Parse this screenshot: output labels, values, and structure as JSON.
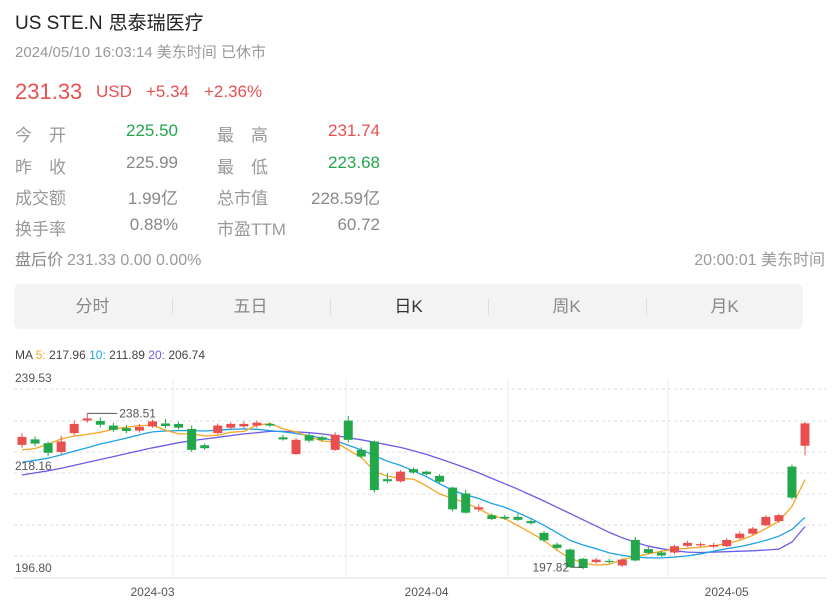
{
  "header": {
    "ticker": "US STE.N",
    "name": "思泰瑞医疗",
    "timestamp": "2024/05/10 16:03:14 美东时间 已休市"
  },
  "quote": {
    "price": "231.33",
    "currency": "USD",
    "change": "+5.34",
    "change_pct": "+2.36%"
  },
  "stats": {
    "open_label": "今　开",
    "open": "225.50",
    "high_label": "最　高",
    "high": "231.74",
    "prev_close_label": "昨　收",
    "prev_close": "225.99",
    "low_label": "最　低",
    "low": "223.68",
    "turnover_label": "成交额",
    "turnover": "1.99亿",
    "mktcap_label": "总市值",
    "mktcap": "228.59亿",
    "turnover_rate_label": "换手率",
    "turnover_rate": "0.88%",
    "pe_label": "市盈TTM",
    "pe": "60.72"
  },
  "after_hours": {
    "label": "盘后价",
    "value": "231.33 0.00 0.00%",
    "time": "20:00:01 美东时间"
  },
  "tabs": [
    {
      "label": "分时"
    },
    {
      "label": "五日"
    },
    {
      "label": "日K"
    },
    {
      "label": "周K"
    },
    {
      "label": "月K"
    }
  ],
  "active_tab": "日K",
  "ma_legend": {
    "prefix": "MA",
    "ma5_label": "5:",
    "ma5": "217.96",
    "ma10_label": "10:",
    "ma10": "211.89",
    "ma20_label": "20:",
    "ma20": "206.74"
  },
  "colors": {
    "up": "#e8504f",
    "down": "#22a74b",
    "ma5": "#f5a623",
    "ma10": "#1ea0e6",
    "ma20": "#6c5ce7"
  },
  "chart_data": {
    "type": "candlestick",
    "y_labels": [
      "239.53",
      "218.16",
      "196.80"
    ],
    "ylim": [
      196.8,
      239.53
    ],
    "x_labels": [
      "2024-03",
      "2024-04",
      "2024-05"
    ],
    "x_label_indices": [
      10,
      31,
      54
    ],
    "high_annotation": "238.51",
    "low_annotation": "197.82",
    "candles": [
      [
        226.2,
        228.1,
        229.0,
        225.5
      ],
      [
        227.5,
        226.5,
        228.2,
        225.8
      ],
      [
        226.6,
        224.3,
        227.0,
        223.5
      ],
      [
        224.5,
        227.0,
        228.4,
        224.0
      ],
      [
        229.0,
        231.2,
        232.0,
        228.5
      ],
      [
        232.0,
        232.5,
        233.7,
        231.5
      ],
      [
        231.9,
        231.0,
        232.8,
        230.4
      ],
      [
        230.8,
        229.8,
        231.5,
        229.3
      ],
      [
        230.2,
        229.5,
        230.9,
        229.0
      ],
      [
        229.6,
        230.5,
        231.2,
        229.1
      ],
      [
        230.6,
        231.8,
        232.2,
        230.3
      ],
      [
        231.3,
        230.7,
        232.4,
        230.2
      ],
      [
        231.2,
        230.3,
        231.7,
        229.9
      ],
      [
        230.0,
        225.0,
        230.8,
        224.5
      ],
      [
        226.1,
        225.4,
        226.5,
        225.0
      ],
      [
        229.0,
        230.8,
        231.3,
        228.7
      ],
      [
        230.3,
        231.2,
        231.6,
        229.8
      ],
      [
        230.6,
        231.2,
        231.8,
        230.2
      ],
      [
        230.8,
        231.5,
        232.0,
        230.3
      ],
      [
        231.2,
        230.8,
        231.6,
        230.4
      ],
      [
        228.0,
        227.5,
        228.6,
        227.2
      ],
      [
        224.0,
        227.4,
        227.8,
        223.8
      ],
      [
        228.5,
        227.2,
        229.0,
        226.8
      ],
      [
        228.0,
        227.4,
        228.4,
        227.0
      ],
      [
        225.0,
        228.6,
        229.2,
        224.8
      ],
      [
        232.0,
        227.4,
        233.1,
        226.8
      ],
      [
        225.0,
        223.4,
        225.6,
        223.0
      ],
      [
        227.0,
        215.4,
        227.3,
        214.8
      ],
      [
        218.0,
        217.5,
        219.4,
        217.0
      ],
      [
        217.5,
        219.8,
        220.2,
        217.2
      ],
      [
        220.4,
        219.6,
        220.8,
        219.3
      ],
      [
        219.8,
        219.2,
        220.0,
        218.9
      ],
      [
        218.8,
        217.4,
        219.2,
        217.0
      ],
      [
        216.0,
        210.8,
        216.2,
        210.3
      ],
      [
        214.6,
        210.0,
        215.5,
        209.8
      ],
      [
        210.8,
        211.3,
        212.0,
        210.2
      ],
      [
        209.4,
        208.5,
        209.8,
        208.2
      ],
      [
        209.0,
        208.6,
        209.5,
        208.3
      ],
      [
        209.0,
        208.3,
        209.8,
        208.0
      ],
      [
        208.0,
        207.5,
        208.4,
        207.2
      ],
      [
        205.2,
        203.4,
        205.6,
        203.0
      ],
      [
        202.4,
        201.6,
        202.9,
        201.2
      ],
      [
        201.2,
        197.0,
        201.5,
        196.8
      ],
      [
        199.0,
        196.8,
        199.2,
        196.5
      ],
      [
        198.2,
        198.8,
        199.2,
        197.8
      ],
      [
        198.5,
        198.4,
        199.0,
        197.9
      ],
      [
        197.4,
        198.8,
        199.1,
        197.1
      ],
      [
        203.5,
        198.6,
        204.2,
        198.4
      ],
      [
        201.3,
        200.4,
        201.8,
        200.1
      ],
      [
        200.5,
        199.8,
        200.9,
        199.5
      ],
      [
        200.5,
        202.0,
        202.3,
        200.2
      ],
      [
        202.1,
        202.8,
        203.3,
        201.8
      ],
      [
        202.2,
        202.5,
        202.9,
        201.9
      ],
      [
        201.9,
        202.3,
        202.8,
        201.5
      ],
      [
        202.0,
        203.5,
        203.9,
        201.8
      ],
      [
        203.9,
        205.0,
        205.5,
        203.6
      ],
      [
        205.0,
        206.2,
        206.6,
        204.7
      ],
      [
        207.0,
        209.0,
        209.4,
        206.8
      ],
      [
        208.0,
        209.4,
        209.7,
        207.6
      ],
      [
        221.0,
        213.6,
        221.5,
        213.2
      ],
      [
        225.99,
        231.33,
        231.74,
        223.68
      ]
    ],
    "ma5": [
      225.0,
      225.3,
      226.4,
      227.6,
      228.3,
      228.7,
      229.2,
      229.9,
      230.4,
      230.8,
      230.9,
      229.7,
      228.8,
      228.8,
      228.3,
      228.5,
      229.2,
      229.4,
      230.9,
      231.3,
      230.0,
      229.3,
      228.2,
      227.1,
      226.9,
      225.0,
      223.2,
      219.9,
      218.7,
      218.2,
      218.0,
      216.4,
      214.5,
      213.4,
      212.4,
      210.9,
      209.3,
      208.6,
      206.9,
      205.2,
      203.4,
      201.0,
      199.1,
      198.0,
      197.5,
      197.7,
      198.8,
      199.5,
      200.2,
      200.8,
      201.3,
      201.5,
      201.8,
      202.1,
      202.6,
      203.4,
      204.6,
      206.2,
      208.0,
      211.5,
      217.9
    ],
    "ma10": [
      222.0,
      222.5,
      223.0,
      223.8,
      224.7,
      225.5,
      226.4,
      227.1,
      227.8,
      228.6,
      229.3,
      229.5,
      229.6,
      229.6,
      229.5,
      229.7,
      229.9,
      230.0,
      229.9,
      229.6,
      229.3,
      228.9,
      228.4,
      227.8,
      227.2,
      226.1,
      225.0,
      223.6,
      222.3,
      221.3,
      220.0,
      218.6,
      216.9,
      215.3,
      214.3,
      213.4,
      212.2,
      211.3,
      210.0,
      208.6,
      207.0,
      205.2,
      203.4,
      202.3,
      201.4,
      200.4,
      199.8,
      199.4,
      199.2,
      199.2,
      199.4,
      199.7,
      200.2,
      200.8,
      201.4,
      201.9,
      202.6,
      203.4,
      204.4,
      206.0,
      208.9
    ],
    "ma20": [
      219.0,
      219.5,
      220.0,
      220.6,
      221.3,
      222.0,
      222.7,
      223.4,
      224.1,
      224.8,
      225.5,
      226.1,
      226.7,
      227.2,
      227.6,
      228.0,
      228.4,
      228.8,
      229.1,
      229.4,
      229.4,
      229.3,
      229.1,
      228.8,
      228.4,
      227.9,
      227.4,
      226.8,
      226.2,
      225.6,
      224.8,
      223.9,
      222.9,
      221.8,
      220.7,
      219.5,
      218.2,
      216.9,
      215.6,
      214.2,
      212.8,
      211.3,
      209.8,
      208.3,
      206.8,
      205.3,
      204.0,
      202.9,
      202.0,
      201.4,
      200.9,
      200.6,
      200.5,
      200.6,
      200.7,
      200.8,
      200.9,
      201.1,
      201.3,
      203.0,
      206.7
    ]
  }
}
